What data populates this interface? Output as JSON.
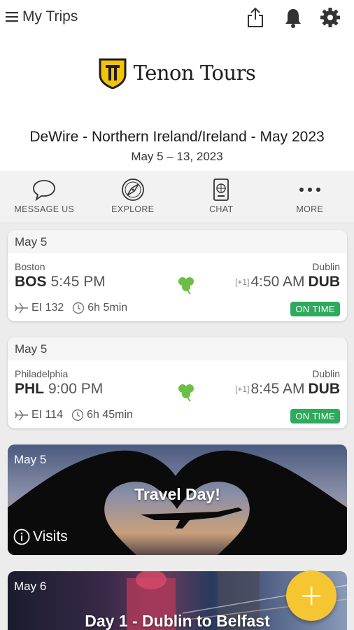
{
  "header": {
    "title": "My Trips",
    "icons": [
      "menu-icon",
      "share-icon",
      "bell-icon",
      "gear-icon"
    ]
  },
  "brand": {
    "name": "Tenon Tours",
    "logo_icon": "tenon-shield-logo"
  },
  "trip": {
    "title": "DeWire - Northern Ireland/Ireland - May 2023",
    "dates": "May 5 – 13, 2023"
  },
  "actions": [
    {
      "label": "MESSAGE US",
      "icon": "speech-bubble-icon"
    },
    {
      "label": "EXPLORE",
      "icon": "compass-icon"
    },
    {
      "label": "CHAT",
      "icon": "passport-icon"
    },
    {
      "label": "MORE",
      "icon": "more-dots-icon"
    }
  ],
  "flights": [
    {
      "date": "May 5",
      "from_city": "Boston",
      "from_code": "BOS",
      "dep_time": "5:45 PM",
      "to_city": "Dublin",
      "to_code": "DUB",
      "arr_time": "4:50 AM",
      "day_offset": "[+1]",
      "flight_no": "EI 132",
      "duration": "6h 5min",
      "status": "ON TIME"
    },
    {
      "date": "May 5",
      "from_city": "Philadelphia",
      "from_code": "PHL",
      "dep_time": "9:00 PM",
      "to_city": "Dublin",
      "to_code": "DUB",
      "arr_time": "8:45 AM",
      "day_offset": "[+1]",
      "flight_no": "EI 114",
      "duration": "6h 45min",
      "status": "ON TIME"
    }
  ],
  "days": [
    {
      "date": "May 5",
      "title": "Travel Day!",
      "visits_label": "Visits"
    },
    {
      "date": "May 6",
      "title": "Day 1 - Dublin to Belfast"
    }
  ],
  "colors": {
    "status_green": "#2eaa5c",
    "fab_yellow": "#f5c631",
    "logo_yellow": "#f5c400",
    "shamrock": "#6cbf45"
  }
}
